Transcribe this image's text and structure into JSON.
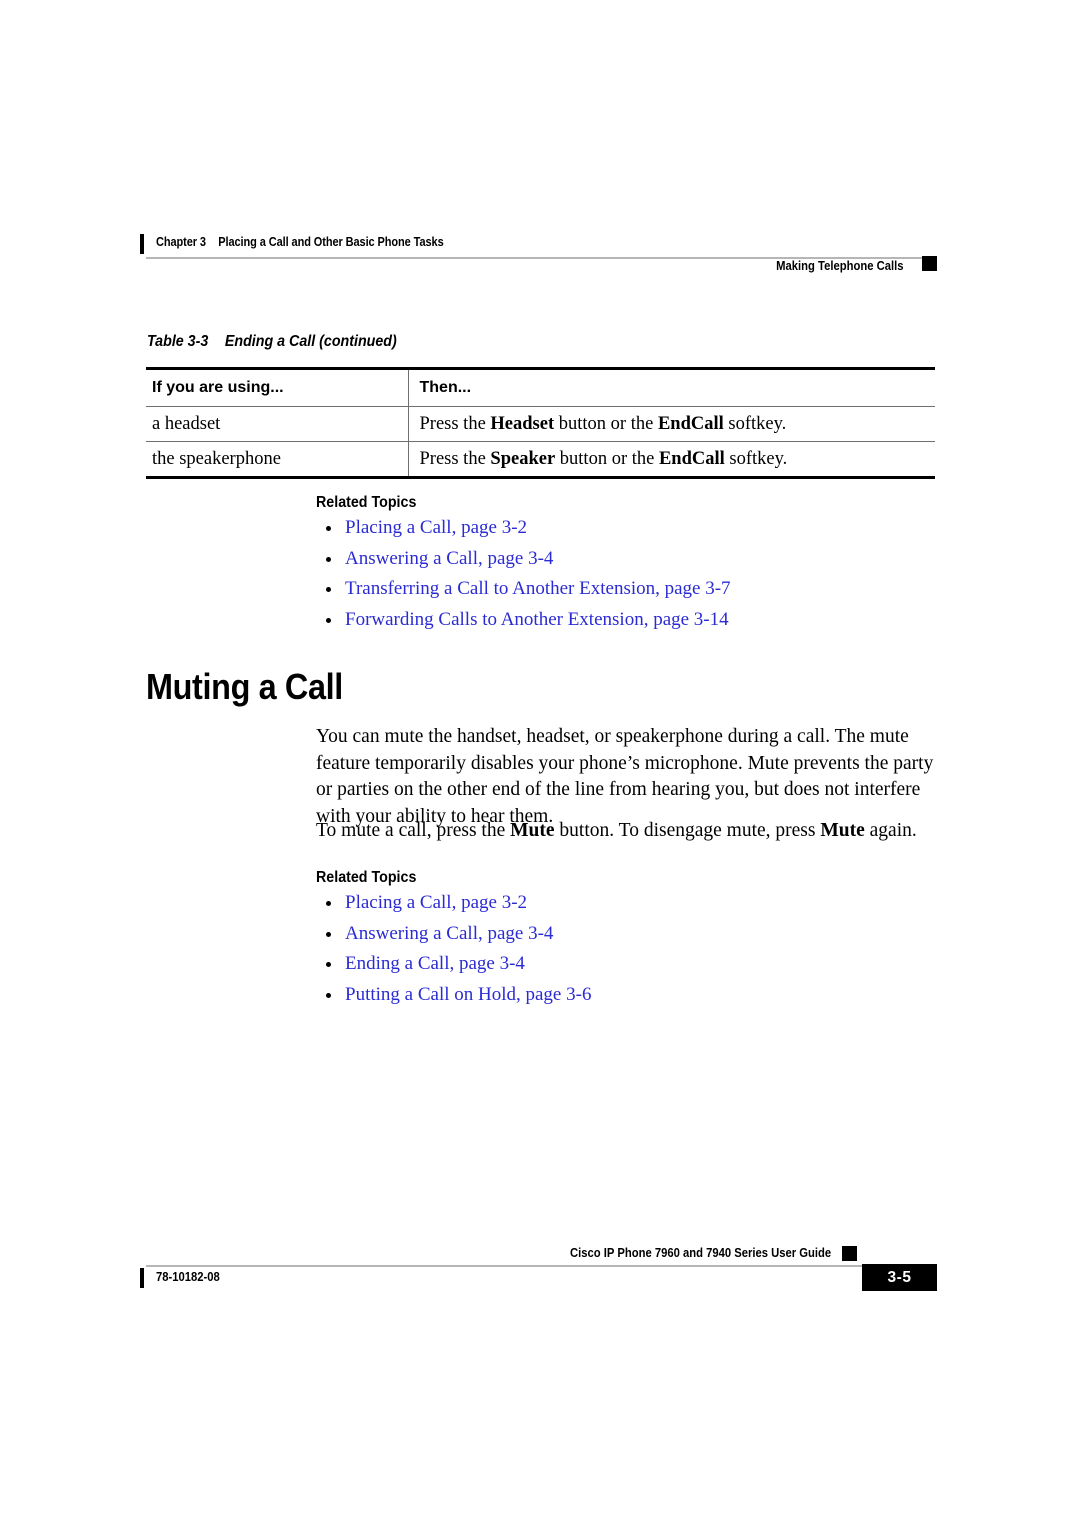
{
  "running_header": {
    "chapter_number": "Chapter  3",
    "chapter_title": "Placing a Call and Other Basic Phone Tasks",
    "section_title": "Making Telephone Calls"
  },
  "table": {
    "caption_number": "Table 3-3",
    "caption_title": "Ending a Call (continued)",
    "columns": [
      "If you are using...",
      "Then..."
    ],
    "rows": [
      {
        "using": "a headset",
        "then_prefix": "Press the ",
        "then_bold1": "Headset",
        "then_mid": " button or the ",
        "then_bold2": "EndCall",
        "then_suffix": " softkey."
      },
      {
        "using": "the speakerphone",
        "then_prefix": "Press the ",
        "then_bold1": "Speaker",
        "then_mid": " button or the ",
        "then_bold2": "EndCall",
        "then_suffix": " softkey."
      }
    ]
  },
  "related_topics_1": {
    "title": "Related Topics",
    "links": [
      "Placing a Call, page 3-2",
      "Answering a Call, page 3-4",
      "Transferring a Call to Another Extension, page 3-7",
      "Forwarding Calls to Another Extension, page 3-14"
    ]
  },
  "section": {
    "heading": "Muting a Call",
    "paragraph_1": "You can mute the handset, headset, or speakerphone during a call. The mute feature temporarily disables your phone’s microphone. Mute prevents the party or parties on the other end of the line from hearing you, but does not interfere with your ability to hear them.",
    "paragraph_2": {
      "prefix": "To mute a call, press the ",
      "bold1": "Mute",
      "mid": " button. To disengage mute, press ",
      "bold2": "Mute",
      "suffix": " again."
    }
  },
  "related_topics_2": {
    "title": "Related Topics",
    "links": [
      "Placing a Call, page 3-2",
      "Answering a Call, page 3-4",
      "Ending a Call, page 3-4",
      "Putting a Call on Hold, page 3-6"
    ]
  },
  "footer": {
    "guide_title": "Cisco IP Phone 7960 and 7940 Series User Guide",
    "document_number": "78-10182-08",
    "page_number": "3-5"
  },
  "colors": {
    "link": "#2b2bd4",
    "rule": "#b6b6b6",
    "table_border": "#000000",
    "text": "#000000"
  }
}
